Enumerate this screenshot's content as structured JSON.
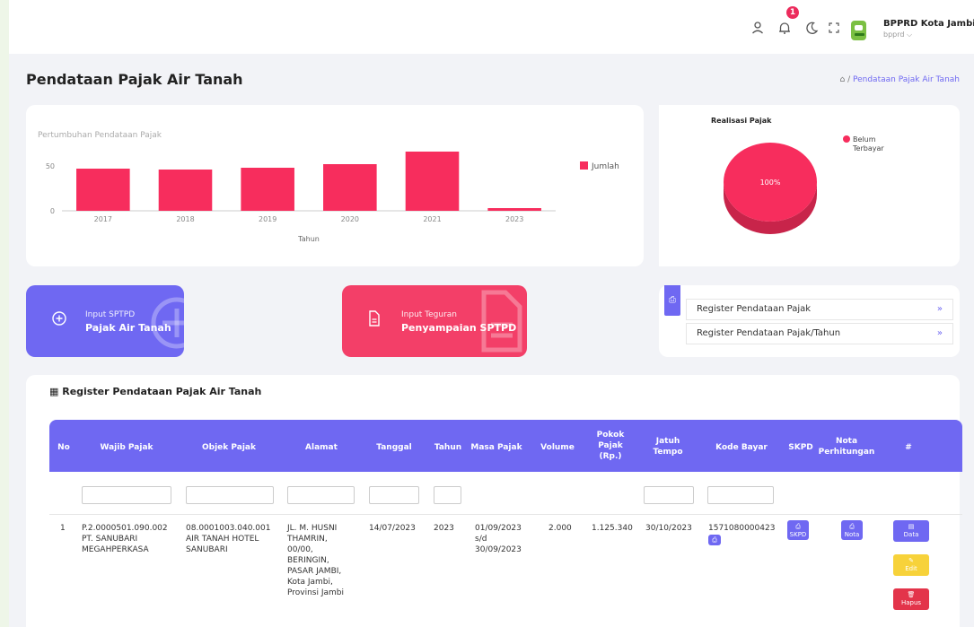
{
  "header": {
    "notification_count": "1",
    "user_name": "BPPRD Kota Jambi",
    "user_sub": "bpprd ⌵",
    "icons": [
      "user-icon",
      "bell-icon",
      "moon-icon",
      "fullscreen-icon"
    ]
  },
  "page": {
    "title": "Pendataan Pajak Air Tanah",
    "breadcrumb_sep": "/",
    "breadcrumb_current": "Pendataan Pajak Air Tanah"
  },
  "chart_data": [
    {
      "type": "bar",
      "title": "Pertumbuhan Pendataan Pajak",
      "categories": [
        "2017",
        "2018",
        "2019",
        "2020",
        "2021",
        "2023"
      ],
      "series": [
        {
          "name": "Jumlah",
          "values": [
            47,
            46,
            48,
            52,
            66,
            3
          ]
        }
      ],
      "xlabel": "Tahun",
      "ylabel": "",
      "yticks": [
        "0",
        "50"
      ],
      "ylim": [
        0,
        70
      ],
      "legend_label": "Jumlah",
      "color": "#f72d5d",
      "legend": "right"
    },
    {
      "type": "pie",
      "title": "Realisasi Pajak",
      "labels": [
        "Belum Terbayar"
      ],
      "values": [
        100
      ],
      "slice_label": "100%",
      "legend_lines": [
        "Belum",
        "Terbayar"
      ],
      "color": "#f72d5d",
      "legend": "top-right"
    }
  ],
  "actions": {
    "input_sptpd_small": "Input SPTPD",
    "input_sptpd_big": "Pajak Air Tanah",
    "teguran_small": "Input Teguran",
    "teguran_big": "Penyampaian SPTPD"
  },
  "registers": [
    {
      "label": "Register Pendataan Pajak",
      "arrow": "»"
    },
    {
      "label": "Register Pendataan Pajak/Tahun",
      "arrow": "»"
    }
  ],
  "table": {
    "title": "▦ Register Pendataan Pajak Air Tanah",
    "headers": {
      "no": "No",
      "wajib": "Wajib Pajak",
      "objek": "Objek Pajak",
      "alamat": "Alamat",
      "tanggal": "Tanggal",
      "tahun": "Tahun",
      "masa": "Masa Pajak",
      "volume": "Volume",
      "pokok1": "Pokok",
      "pokok2": "Pajak",
      "pokok3": "(Rp.)",
      "jatuh1": "Jatuh",
      "jatuh2": "Tempo",
      "kode": "Kode Bayar",
      "skpd": "SKPD",
      "nota1": "Nota",
      "nota2": "Perhitungan",
      "hash": "#"
    },
    "row": {
      "no": "1",
      "wajib1": "P.2.0000501.090.002",
      "wajib2": "PT. SANUBARI",
      "wajib3": "MEGAHPERKASA",
      "objek1": "08.0001003.040.001",
      "objek2": "AIR TANAH HOTEL",
      "objek3": "SANUBARI",
      "alamat1": "JL. M. HUSNI",
      "alamat2": "THAMRIN,",
      "alamat3": "00/00,",
      "alamat4": "BERINGIN,",
      "alamat5": "PASAR JAMBI,",
      "alamat6": "Kota Jambi,",
      "alamat7": "Provinsi Jambi",
      "tanggal": "14/07/2023",
      "tahun": "2023",
      "masa1": "01/09/2023",
      "masa2": "s/d",
      "masa3": "30/09/2023",
      "volume": "2.000",
      "pokok": "1.125.340",
      "jatuh": "30/10/2023",
      "kode": "1571080000423",
      "skpd_btn": "SKPD",
      "nota_btn": "Nota",
      "data_btn": "Data",
      "edit_btn": "Edit",
      "hapus_btn": "Hapus"
    }
  },
  "colors": {
    "primary": "#6f68f2",
    "danger": "#f33f68",
    "warning": "#f7d23a",
    "delete": "#e3344a"
  }
}
